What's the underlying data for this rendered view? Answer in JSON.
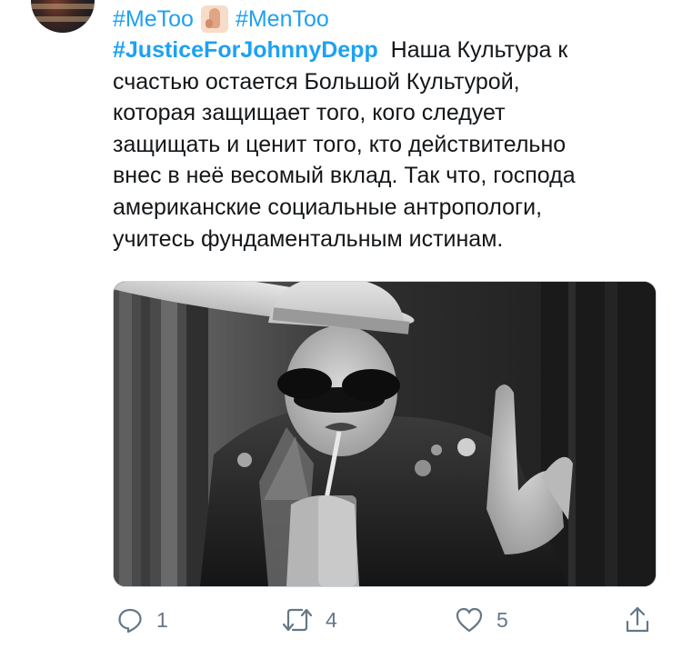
{
  "tweet": {
    "hashtags_top": [
      "#MeToo",
      "#MenToo"
    ],
    "emoji": "hand",
    "bold_hashtag": "#JusticeForJohnnyDepp",
    "lines": [
      "Наша Культура к",
      "счастью остается Большой Культурой,",
      "которая защищает того, кого следует",
      "защищать и ценит того, кто действительно",
      "внес в неё весомый вклад. Так что, господа",
      "американские социальные антропологи,",
      "учитесь фундаментальным истинам."
    ]
  },
  "actions": {
    "reply_count": "1",
    "retweet_count": "4",
    "like_count": "5"
  },
  "icons": {
    "reply": "reply-icon",
    "retweet": "retweet-icon",
    "like": "heart-icon",
    "share": "share-icon"
  },
  "colors": {
    "link": "#1da1f2",
    "text": "#14171a",
    "muted": "#657786",
    "border": "#ccd6dd"
  }
}
